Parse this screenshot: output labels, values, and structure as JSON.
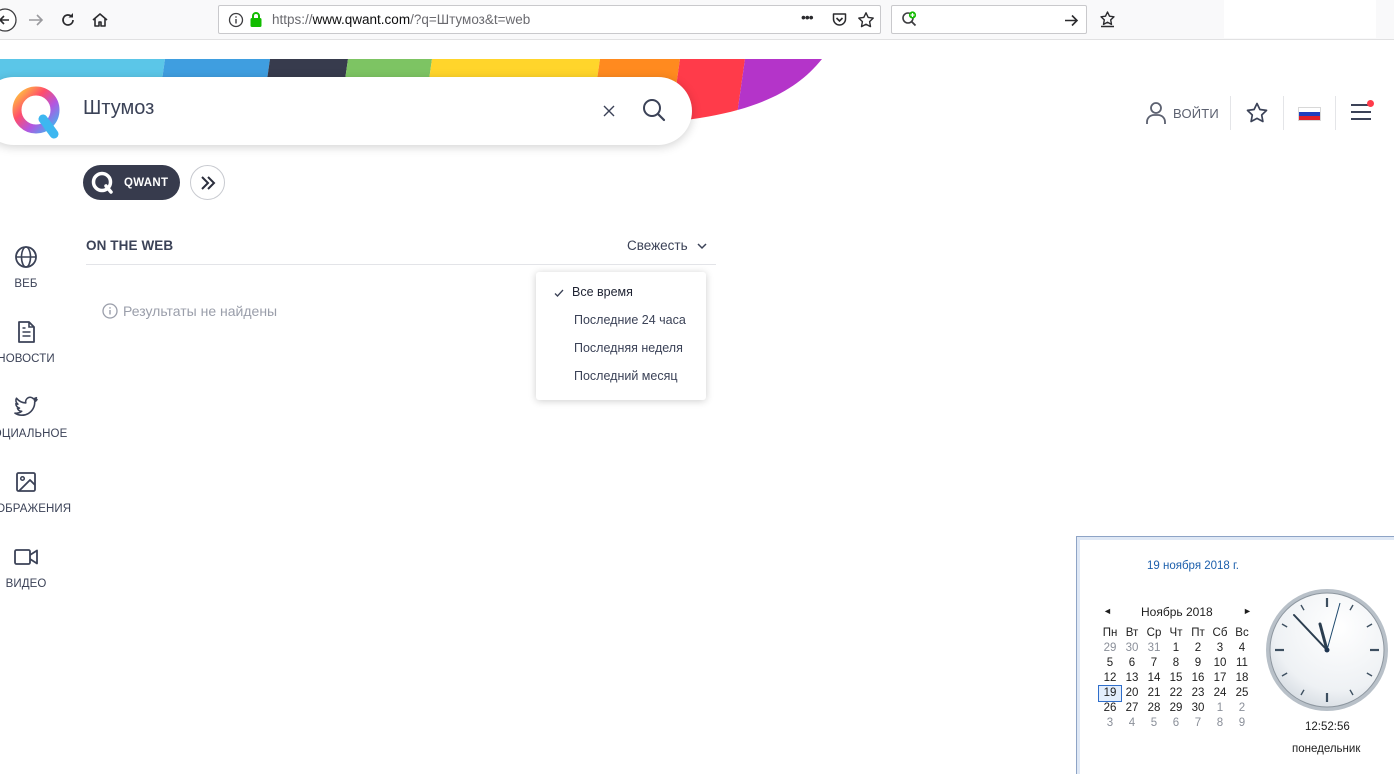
{
  "browser": {
    "url_protocol": "https://",
    "url_host": "www.qwant.com",
    "url_path": "/?q=Штумоз&t=web",
    "page_actions": "•••"
  },
  "search": {
    "query": "Штумоз"
  },
  "header": {
    "login_label": "ВОЙТИ"
  },
  "engine": {
    "qwant_label": "QWANT"
  },
  "rail": {
    "items": [
      {
        "label": "ВЕБ",
        "icon": "globe-icon"
      },
      {
        "label": "НОВОСТИ",
        "icon": "news-icon"
      },
      {
        "label": "СОЦИАЛЬНОЕ",
        "icon": "twitter-icon"
      },
      {
        "label": "ИЗОБРАЖЕНИЯ",
        "icon": "image-icon"
      },
      {
        "label": "ВИДЕО",
        "icon": "video-icon"
      }
    ]
  },
  "results": {
    "section_title": "ON THE WEB",
    "freshness_label": "Свежесть",
    "empty_message": "Результаты не найдены"
  },
  "freshness_menu": {
    "options": [
      {
        "label": "Все время",
        "selected": true
      },
      {
        "label": "Последние 24 часа",
        "selected": false
      },
      {
        "label": "Последняя неделя",
        "selected": false
      },
      {
        "label": "Последний месяц",
        "selected": false
      }
    ]
  },
  "flyout": {
    "date_long": "19 ноября 2018 г.",
    "month_label": "Ноябрь 2018",
    "prev": "◄",
    "next": "►",
    "weekdays": [
      "Пн",
      "Вт",
      "Ср",
      "Чт",
      "Пт",
      "Сб",
      "Вс"
    ],
    "weeks": [
      [
        "29",
        "30",
        "31",
        "1",
        "2",
        "3",
        "4"
      ],
      [
        "5",
        "6",
        "7",
        "8",
        "9",
        "10",
        "11"
      ],
      [
        "12",
        "13",
        "14",
        "15",
        "16",
        "17",
        "18"
      ],
      [
        "19",
        "20",
        "21",
        "22",
        "23",
        "24",
        "25"
      ],
      [
        "26",
        "27",
        "28",
        "29",
        "30",
        "1",
        "2"
      ],
      [
        "3",
        "4",
        "5",
        "6",
        "7",
        "8",
        "9"
      ]
    ],
    "today": "19",
    "time": "12:52:56",
    "weekday": "понедельник"
  },
  "colors": {
    "qwant_dark": "#373b4d",
    "rainbow": [
      "#5bc6e8",
      "#3f9ee0",
      "#373b4d",
      "#7dc463",
      "#ffd52b",
      "#ff8a1f",
      "#ff3b4a",
      "#b434c9"
    ],
    "today_outline": "#2f6ecb",
    "flyout_date": "#1c5fac"
  }
}
